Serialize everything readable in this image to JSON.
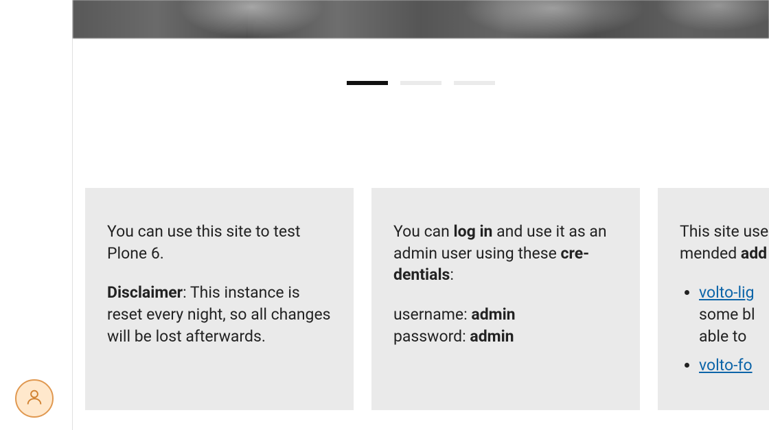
{
  "sidebar": {
    "user_button": "user"
  },
  "hero": {
    "pagination": {
      "active_index": 0,
      "count": 3
    }
  },
  "cards": [
    {
      "text1": "You can use this site to test Plone 6.",
      "disclaimer_label": "Disclaimer",
      "disclaimer_sep": ": ",
      "disclaimer_text": "This instance is reset every night, so all changes will be lost afterwards."
    },
    {
      "prefix": "You can ",
      "login_bold": "log in",
      "mid": " and use it as an admin user using these ",
      "credentials_bold": "cre-dentials",
      "suffix": ":",
      "username_label": "username: ",
      "username_value": "admin",
      "password_label": "password: ",
      "password_value": "admin"
    },
    {
      "line_prefix": "This site use",
      "line_mid": "mended ",
      "line_bold": "add",
      "links": [
        {
          "text": "volto-lig",
          "tail1": "some bl",
          "tail2": "able to "
        },
        {
          "text": "volto-fo"
        }
      ]
    }
  ]
}
